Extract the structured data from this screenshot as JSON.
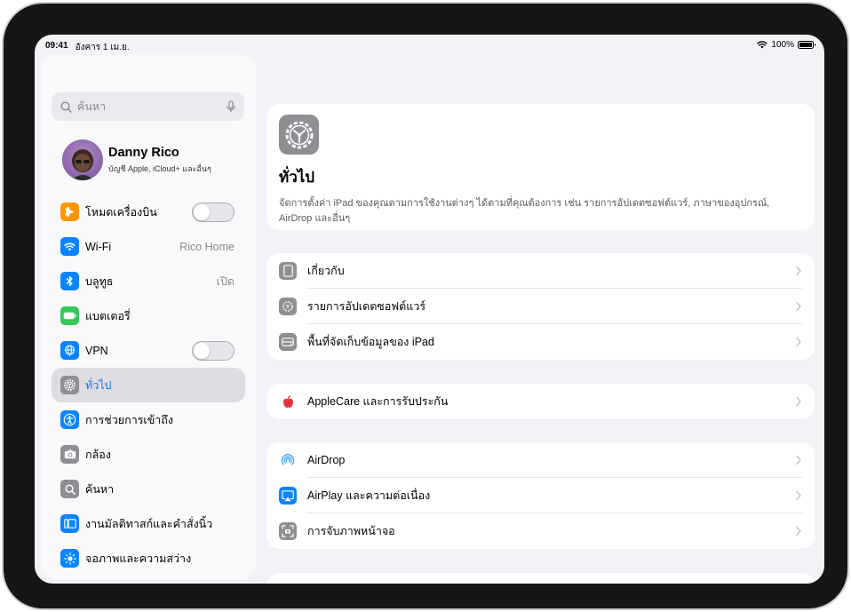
{
  "status": {
    "time": "09:41",
    "date": "อังคาร 1 เม.ย.",
    "battery": "100%"
  },
  "sidebar": {
    "search_placeholder": "ค้นหา",
    "profile": {
      "name": "Danny Rico",
      "subtitle": "บัญชี Apple, iCloud+ และอื่นๆ"
    },
    "items": [
      {
        "label": "โหมดเครื่องบิน",
        "icon": "airplane-icon",
        "color": "#ff9500",
        "toggle": false
      },
      {
        "label": "Wi-Fi",
        "icon": "wifi-icon",
        "color": "#0a84ff",
        "value": "Rico Home"
      },
      {
        "label": "บลูทูธ",
        "icon": "bluetooth-icon",
        "color": "#0a84ff",
        "value": "เปิด"
      },
      {
        "label": "แบตเตอรี่",
        "icon": "battery-icon",
        "color": "#34c759"
      },
      {
        "label": "VPN",
        "icon": "vpn-icon",
        "color": "#0a84ff",
        "toggle": false
      },
      {
        "label": "ทั่วไป",
        "icon": "gear-icon",
        "color": "#8e8e93",
        "selected": true
      },
      {
        "label": "การช่วยการเข้าถึง",
        "icon": "accessibility-icon",
        "color": "#0a84ff"
      },
      {
        "label": "กล้อง",
        "icon": "camera-icon",
        "color": "#8e8e93"
      },
      {
        "label": "ค้นหา",
        "icon": "search-icon",
        "color": "#8e8e93"
      },
      {
        "label": "งานมัลติทาสก์และคำสั่งนิ้ว",
        "icon": "multitasking-icon",
        "color": "#0a84ff"
      },
      {
        "label": "จอภาพและความสว่าง",
        "icon": "brightness-icon",
        "color": "#0a84ff"
      }
    ]
  },
  "main": {
    "hero": {
      "title": "ทั่วไป",
      "description": "จัดการตั้งค่า iPad ของคุณตามการใช้งานต่างๆ ได้ตามที่คุณต้องการ เช่น รายการอัปเดตซอฟต์แวร์, ภาษาของอุปกรณ์, AirDrop และอื่นๆ"
    },
    "group1": [
      {
        "label": "เกี่ยวกับ",
        "icon": "ipad-icon"
      },
      {
        "label": "รายการอัปเดตซอฟต์แวร์",
        "icon": "gear-icon"
      },
      {
        "label": "พื้นที่จัดเก็บข้อมูลของ iPad",
        "icon": "storage-icon"
      }
    ],
    "group2": [
      {
        "label": "AppleCare และการรับประกัน",
        "icon": "apple-icon"
      }
    ],
    "group3": [
      {
        "label": "AirDrop",
        "icon": "airdrop-icon"
      },
      {
        "label": "AirPlay และความต่อเนื่อง",
        "icon": "airplay-icon"
      },
      {
        "label": "การจับภาพหน้าจอ",
        "icon": "screen-capture-icon"
      }
    ]
  }
}
